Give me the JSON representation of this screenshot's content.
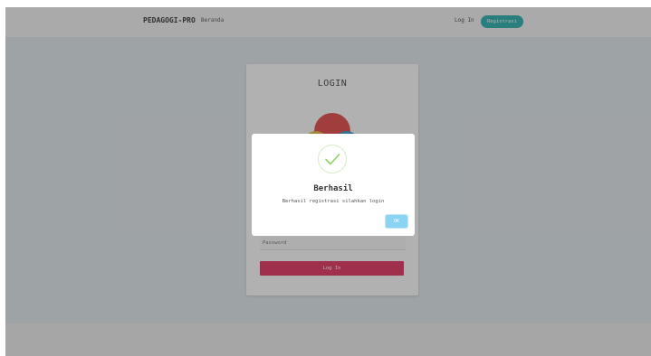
{
  "navbar": {
    "brand": "PEDAGOGI-PRO",
    "nav_home": "Beranda",
    "login_label": "Log In",
    "register_label": "Registrasi",
    "accent_color": "#19a7a7"
  },
  "login_card": {
    "title": "LOGIN",
    "password_placeholder": "Password",
    "submit_label": "Log In",
    "submit_color": "#e0204f"
  },
  "dialog": {
    "icon": "checkmark-success-icon",
    "title": "Berhasil",
    "message": "Berhasil registrasi silahkan login",
    "ok_label": "OK",
    "ok_color": "#8ad3f3"
  }
}
